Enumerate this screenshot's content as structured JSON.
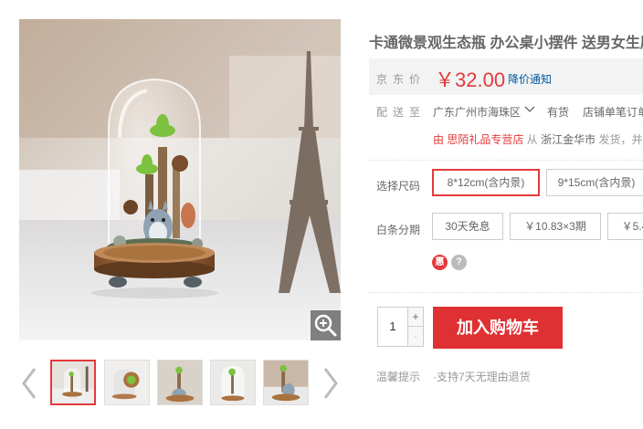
{
  "product": {
    "title": "卡通微景观生态瓶 办公桌小摆件 送男女生朋"
  },
  "price": {
    "label": "京东价",
    "value": "￥32.00",
    "alert": "降价通知"
  },
  "shipping": {
    "label": "配送至",
    "area": "广东广州市海珠区",
    "stock": "有货",
    "service": "店铺单笔订单",
    "from_prefix": "由",
    "shop": "思陌礼品专营店",
    "from_middle": "从",
    "origin": "浙江金华市",
    "from_suffix": "发货，并"
  },
  "size": {
    "label": "选择尺码",
    "options": [
      "8*12cm(含内景)",
      "9*15cm(含内景)"
    ],
    "selected": "8*12cm(含内景)"
  },
  "installment": {
    "label": "白条分期",
    "options": [
      "30天免息",
      "￥10.83×3期",
      "￥5.4"
    ]
  },
  "icons": {
    "coupon": "惠",
    "help": "?"
  },
  "quantity": {
    "value": "1",
    "plus": "+",
    "minus": "-"
  },
  "cart": {
    "label": "加入购物车"
  },
  "tips": {
    "label": "温馨提示",
    "text": "·支持7天无理由退货"
  },
  "colors": {
    "accent": "#e4393c",
    "link": "#005aa0"
  }
}
